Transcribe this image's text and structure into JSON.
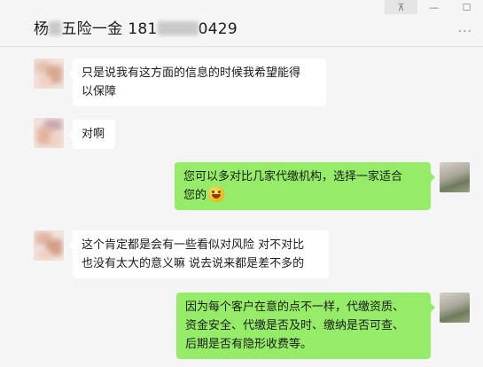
{
  "window": {
    "pin_glyph": "⊼",
    "minimize_glyph": "—",
    "maximize_glyph": "☐"
  },
  "chat": {
    "title_prefix": "杨",
    "title_middle": "五险一金 181",
    "title_suffix": "0429",
    "more_glyph": "···"
  },
  "messages": [
    {
      "side": "in",
      "lines": [
        "只是说我有这方面的信息的时候我希望能得",
        "以保障"
      ]
    },
    {
      "side": "in",
      "lines": [
        "对啊"
      ]
    },
    {
      "side": "out",
      "lines": [
        "您可以多对比几家代缴机构，选择一家适合",
        "您的"
      ],
      "emoji": "grin-emoji"
    },
    {
      "side": "in",
      "lines": [
        "这个肯定都是会有一些看似对风险 对不对比",
        "也没有太大的意义嘛 说去说来都是差不多的"
      ]
    },
    {
      "side": "out",
      "lines": [
        "因为每个客户在意的点不一样，代缴资质、",
        "资金安全、代缴是否及时、缴纳是否可查、",
        "后期是否有隐形收费等。"
      ]
    }
  ],
  "colors": {
    "background": "#f5f5f5",
    "incoming_bubble": "#ffffff",
    "outgoing_bubble": "#95ec69"
  }
}
